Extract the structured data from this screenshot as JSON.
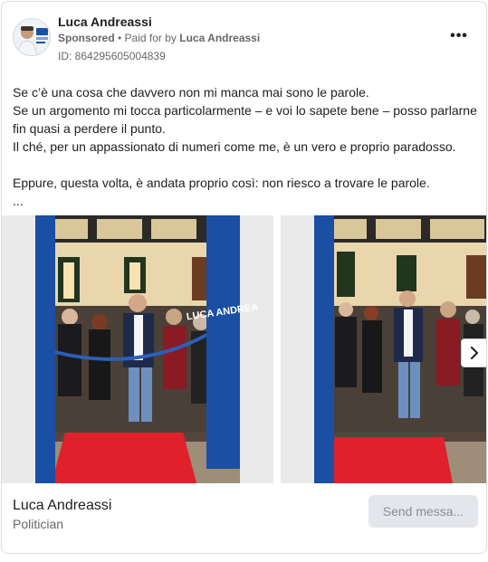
{
  "post": {
    "author_name": "Luca Andreassi",
    "sponsored_label": "Sponsored",
    "separator": " • ",
    "paid_for_prefix": "Paid for by ",
    "paid_for_name": "Luca Andreassi",
    "ad_id": "ID: 864295605004839",
    "more_icon": "more-options-icon",
    "more_label": "•••"
  },
  "body": {
    "lines": [
      "Se c’è una cosa che davvero non mi manca mai sono le parole.",
      "Se un argomento mi tocca particolarmente – e voi lo sapete bene – posso parlarne fin quasi a perdere il punto.",
      "Il ché, per un appassionato di numeri come me, è un vero e proprio paradosso.",
      "Eppure, questa volta, è andata proprio così: non riesco a trovare le parole.",
      "..."
    ]
  },
  "carousel": {
    "banner_text": "LUCA ANDREA",
    "next_icon": "chevron-right-icon"
  },
  "footer": {
    "name": "Luca Andreassi",
    "subtitle": "Politician",
    "button_label": "Send messa..."
  },
  "colors": {
    "text_primary": "#1c1e21",
    "text_secondary": "#65676b",
    "banner_blue": "#1a4fa3",
    "carpet_red": "#e0202a",
    "button_bg": "#e4e6eb"
  }
}
